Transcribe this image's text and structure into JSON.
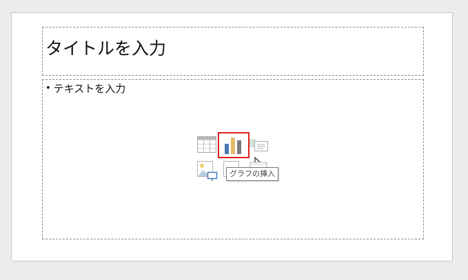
{
  "slide": {
    "title_placeholder": "タイトルを入力",
    "content_placeholder": {
      "bullet": "•",
      "text": "テキストを入力"
    }
  },
  "insert_icons": [
    {
      "name": "table-icon"
    },
    {
      "name": "chart-icon",
      "highlighted": true
    },
    {
      "name": "smartart-icon"
    },
    {
      "name": "picture-icon"
    },
    {
      "name": "online-picture-icon"
    },
    {
      "name": "video-icon"
    }
  ],
  "tooltip": {
    "text": "グラフの挿入"
  },
  "colors": {
    "highlight_border": "#e02020",
    "chart_blue": "#4a7ab5",
    "chart_gold": "#e6b86a",
    "chart_gray": "#7a7a7a",
    "placeholder_border": "#8a8a8a",
    "background": "#ececec"
  }
}
